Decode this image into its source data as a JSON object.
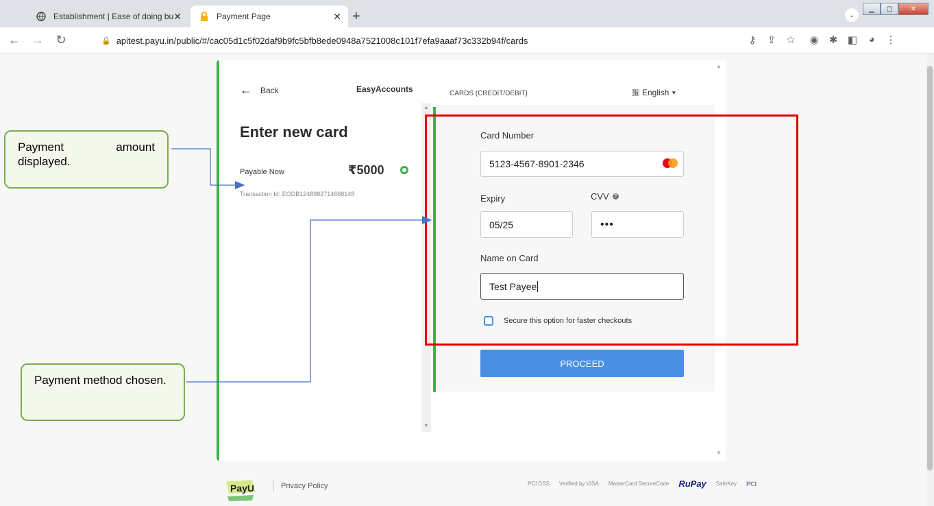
{
  "browser": {
    "tabs": [
      {
        "title": "Establishment | Ease of doing bu",
        "icon": "globe-icon",
        "active": false
      },
      {
        "title": "Payment Page",
        "icon": "lock-icon",
        "active": true
      }
    ],
    "url": "apitest.payu.in/public/#/cac05d1c5f02daf9b9fc5bfb8ede0948a7521008c101f7efa9aaaf73c332b94f/cards"
  },
  "left_panel": {
    "back_label": "Back",
    "merchant": "EasyAccounts",
    "heading": "Enter new card",
    "payable_label": "Payable Now",
    "amount": "₹5000",
    "transaction_id": "Transaction Id: EODB1248982714668148"
  },
  "right_panel": {
    "section_title": "CARDS (CREDIT/DEBIT)",
    "language": "English",
    "card_number_label": "Card Number",
    "card_number": "5123-4567-8901-2346",
    "expiry_label": "Expiry",
    "expiry": "05/25",
    "cvv_label": "CVV",
    "cvv": "•••",
    "name_label": "Name on Card",
    "name": "Test Payee",
    "secure_label": "Secure this option for faster checkouts",
    "secure_checked": false,
    "proceed_label": "PROCEED"
  },
  "footer": {
    "logo_text": "PayU",
    "privacy_label": "Privacy Policy",
    "badges": [
      "PCI DSS",
      "Verified by VISA",
      "MasterCard SecureCode",
      "RuPay",
      "SafeKey",
      "PCI"
    ]
  },
  "annotations": {
    "callout1": "Payment amount displayed.",
    "callout2": "Payment method chosen."
  },
  "colors": {
    "accent_green": "#3bb54a",
    "button_blue": "#4a90e2",
    "highlight_red": "#e00000",
    "callout_border": "#7aac4d",
    "arrow_blue": "#4472c4"
  }
}
